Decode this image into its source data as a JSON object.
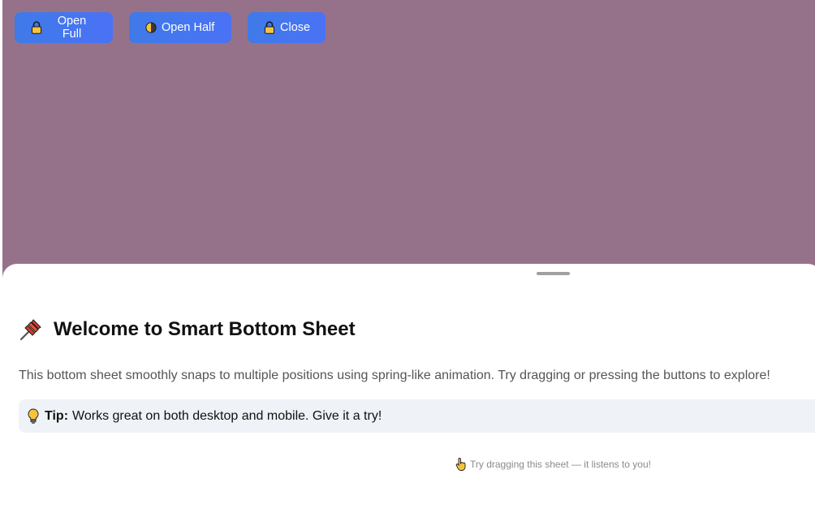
{
  "toolbar": {
    "open_full_label": "Open Full",
    "open_full_icon": "lock-icon",
    "open_half_label": "Open Half",
    "open_half_icon": "half-moon-icon",
    "close_label": "Close",
    "close_icon": "lock-icon"
  },
  "sheet": {
    "title": "Welcome to Smart Bottom Sheet",
    "title_icon": "pushpin-icon",
    "description": "This bottom sheet smoothly snaps to multiple positions using spring-like animation. Try dragging or pressing the buttons to explore!",
    "tip_icon": "lightbulb-icon",
    "tip_label": "Tip:",
    "tip_text": "Works great on both desktop and mobile. Give it a try!",
    "hint_icon": "pointing-hand-icon",
    "hint_text": "Try dragging this sheet — it listens to you!"
  },
  "colors": {
    "backdrop": "#96728a",
    "button": "#4a72f6",
    "sheet": "#ffffff",
    "tip_background": "#eff2f7"
  }
}
